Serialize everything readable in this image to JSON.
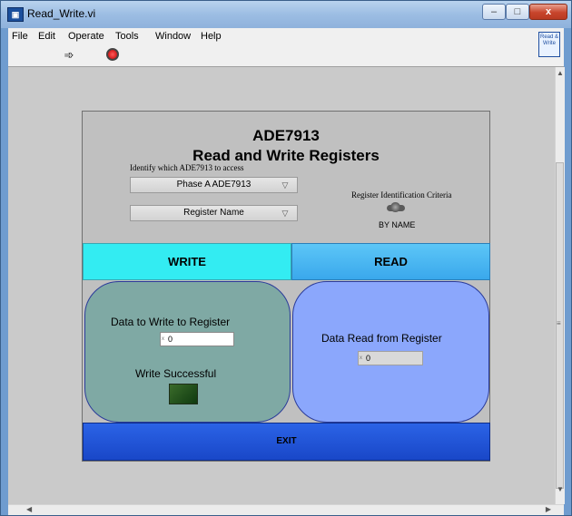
{
  "window": {
    "title": "Read_Write.vi",
    "app_icon": "labview-icon",
    "controls": {
      "minimize": "–",
      "maximize": "□",
      "close": "x"
    }
  },
  "menu": [
    "File",
    "Edit",
    "Operate",
    "Tools",
    "Window",
    "Help"
  ],
  "toolbar": {
    "run_icon": "run-arrow-icon",
    "stop_icon": "abort-icon",
    "vi_icon_text": "Read & Write"
  },
  "panel": {
    "title_line1": "ADE7913",
    "title_line2": "Read and Write Registers",
    "identify_label": "Identify which ADE7913 to access",
    "phase_select": "Phase A ADE7913",
    "register_select": "Register Name",
    "criteria_label": "Register Identification Criteria",
    "criteria_value": "BY NAME",
    "write_button": "WRITE",
    "read_button": "READ",
    "write_box": {
      "data_label": "Data to Write to Register",
      "data_value": "0",
      "radix": "x",
      "success_label": "Write Successful",
      "success_on": false
    },
    "read_box": {
      "data_label": "Data Read from Register",
      "data_value": "0",
      "radix": "x"
    },
    "exit_button": "EXIT"
  },
  "colors": {
    "write_button": "#33ecf2",
    "read_button": "#3aa8ec",
    "write_box": "#7fa9a4",
    "read_box": "#8ba7fc",
    "exit_button": "#1947c8",
    "panel_bg": "#c0c0c0"
  }
}
